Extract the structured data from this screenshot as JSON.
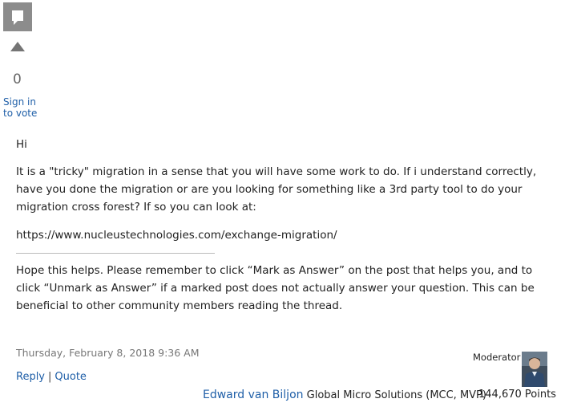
{
  "sidebar": {
    "icons": {
      "comment": "comment-icon",
      "vote_up": "triangle-up-icon"
    },
    "vote_count": "0",
    "sign_in_line1": "Sign in",
    "sign_in_line2": "to vote"
  },
  "post": {
    "greeting": "Hi",
    "body": "It is a \"tricky\" migration in a sense that you will have some work to do. If i understand correctly, have you done the migration or are you looking for something like a 3rd party tool to do your migration cross forest? If so you can look at:",
    "url": "https://www.nucleustechnologies.com/exchange-migration/",
    "signature": "Hope this helps. Please remember to click “Mark as Answer” on the post that helps you, and to click “Unmark as Answer” if a marked post does not actually answer your question. This can be beneficial to other community members reading the thread."
  },
  "footer": {
    "timestamp": "Thursday, February 8, 2018 9:36 AM",
    "reply_label": "Reply",
    "separator": "|",
    "quote_label": "Quote"
  },
  "author": {
    "role": "Moderator",
    "name": "Edward van Biljon",
    "affiliation": "Global Micro Solutions (MCC, MVP)",
    "points": "144,670 Points"
  },
  "colors": {
    "link": "#1f5fa8",
    "icon_gray": "#8c8c8c",
    "muted_text": "#777777"
  }
}
